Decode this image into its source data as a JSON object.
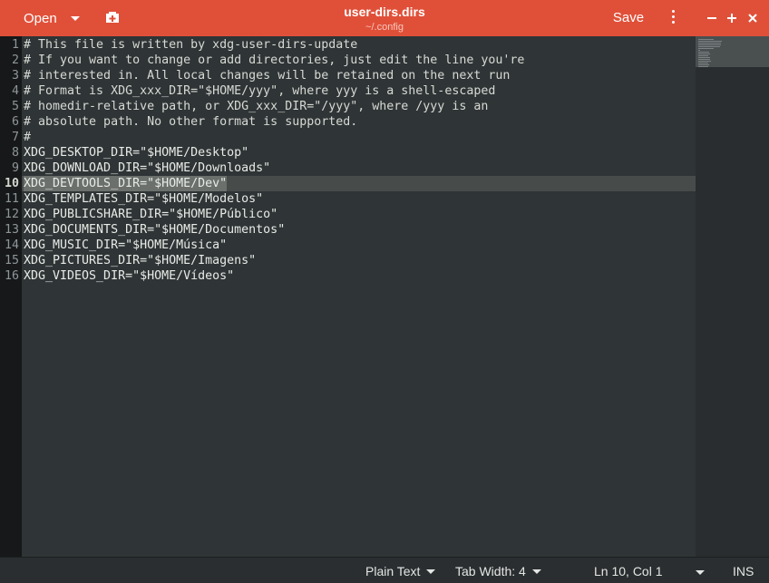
{
  "header": {
    "open_label": "Open",
    "open_menu_icon": "chevron-down-icon",
    "new_document_icon": "new-tab-icon",
    "title": "user-dirs.dirs",
    "subtitle": "~/.config",
    "save_label": "Save",
    "menu_icon": "kebab-menu-icon",
    "window_controls": [
      "minimize-icon",
      "maximize-icon",
      "close-icon"
    ],
    "accent_color": "#e05039"
  },
  "editor": {
    "current_line": 10,
    "selected_line": 10,
    "line_numbers": [
      "1",
      "2",
      "3",
      "4",
      "5",
      "6",
      "7",
      "8",
      "9",
      "10",
      "11",
      "12",
      "13",
      "14",
      "15",
      "16"
    ],
    "lines": [
      "# This file is written by xdg-user-dirs-update",
      "# If you want to change or add directories, just edit the line you're",
      "# interested in. All local changes will be retained on the next run",
      "# Format is XDG_xxx_DIR=\"$HOME/yyy\", where yyy is a shell-escaped",
      "# homedir-relative path, or XDG_xxx_DIR=\"/yyy\", where /yyy is an",
      "# absolute path. No other format is supported.",
      "#",
      "XDG_DESKTOP_DIR=\"$HOME/Desktop\"",
      "XDG_DOWNLOAD_DIR=\"$HOME/Downloads\"",
      "XDG_DEVTOOLS_DIR=\"$HOME/Dev\"",
      "XDG_TEMPLATES_DIR=\"$HOME/Modelos\"",
      "XDG_PUBLICSHARE_DIR=\"$HOME/Público\"",
      "XDG_DOCUMENTS_DIR=\"$HOME/Documentos\"",
      "XDG_MUSIC_DIR=\"$HOME/Música\"",
      "XDG_PICTURES_DIR=\"$HOME/Imagens\"",
      "XDG_VIDEOS_DIR=\"$HOME/Vídeos\""
    ]
  },
  "statusbar": {
    "language": "Plain Text",
    "tab_width": "Tab Width: 4",
    "position": "Ln 10, Col 1",
    "mode": "INS"
  }
}
